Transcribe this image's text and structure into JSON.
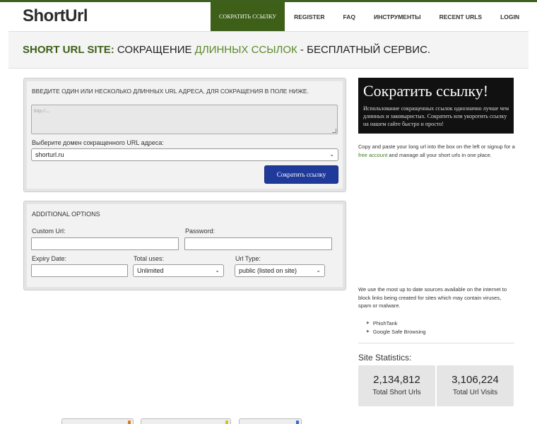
{
  "header": {
    "logo": "ShortUrl",
    "nav": [
      {
        "label": "Сократить ссылку",
        "active": true
      },
      {
        "label": "Register"
      },
      {
        "label": "FAQ"
      },
      {
        "label": "Инструменты"
      },
      {
        "label": "Recent Urls"
      },
      {
        "label": "Login"
      }
    ]
  },
  "subhead": {
    "site": "SHORT URL SITE:",
    "part1": " СОКРАЩЕНИЕ ",
    "green": "ДЛИННЫХ ССЫЛОК",
    "part2": " - БЕСПЛАТНЫЙ СЕРВИС."
  },
  "shorten_form": {
    "instruction": "Введите один или несколько длинных URL адреса, для сокращения в поле ниже.",
    "textarea_placeholder": "http://...",
    "domain_label": "Выберите домен сокращенного URL адреса:",
    "domain_value": "shorturl.ru",
    "submit_label": "Сократить ссылку"
  },
  "options": {
    "title": "ADDITIONAL OPTIONS",
    "custom_url_label": "Custom Url:",
    "password_label": "Password:",
    "expiry_label": "Expiry Date:",
    "total_uses_label": "Total uses:",
    "total_uses_value": "Unlimited",
    "url_type_label": "Url Type:",
    "url_type_value": "public (listed on site)"
  },
  "promo": {
    "title": "Сократить ссылку!",
    "text": "Использование сокращенных ссылок однозначно лучше чем длинных и заковыристых. Сократить или укоротить ссылку на нашем сайте быстро и просто!"
  },
  "sidebar": {
    "copy_text_1": "Copy and paste your long url into the box on the left or signup for a ",
    "copy_link": "free account",
    "copy_text_2": " and manage all your short urls in one place.",
    "security_text": "We use the most up to date sources available on the internet to block links being created for sites which may contain viruses, spam or malware.",
    "sources": [
      "PhishTank",
      "Google Safe Browsing"
    ]
  },
  "stats": {
    "title": "Site Statistics:",
    "short_urls": {
      "value": "2,134,812",
      "label": "Total Short Urls"
    },
    "url_visits": {
      "value": "3,106,224",
      "label": "Total Url Visits"
    }
  },
  "colors": {
    "brand_green": "#3d5f18",
    "link_green": "#3d7a1f",
    "button_blue": "#1f3a9a"
  }
}
